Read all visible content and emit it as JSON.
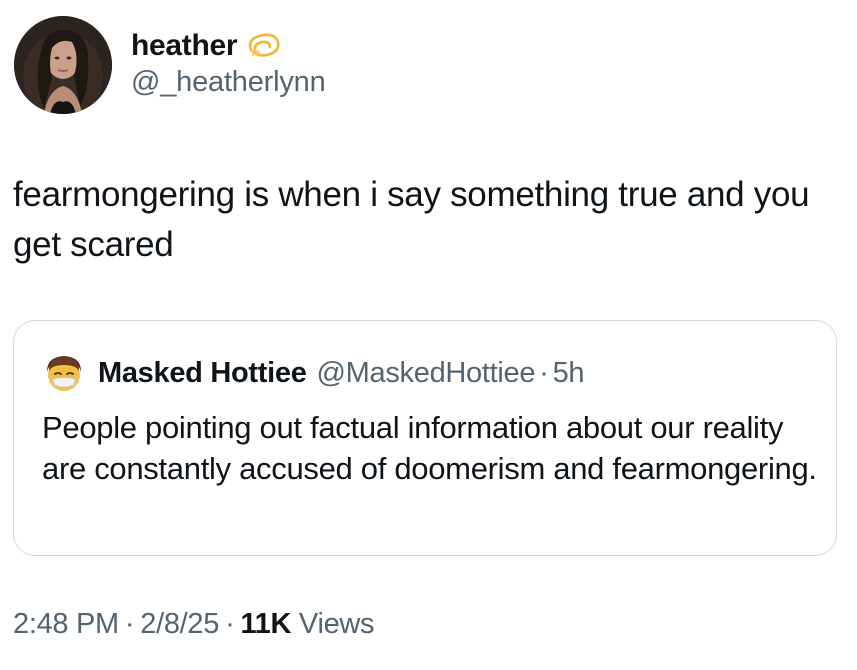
{
  "author": {
    "display_name": "heather",
    "handle": "@_heatherlynn",
    "badge_icon": "dizzy-star-emoji-icon",
    "avatar_icon": "profile-photo-avatar"
  },
  "tweet": {
    "text": "fearmongering is when i say something true and you get scared"
  },
  "quoted_tweet": {
    "avatar_icon": "face-with-mask-emoji-avatar",
    "display_name": "Masked Hottiee",
    "handle": "@MaskedHottiee",
    "separator": "·",
    "time": "5h",
    "text": "People pointing out factual information about our reality are constantly accused of doomerism and fearmongering."
  },
  "meta": {
    "time": "2:48 PM",
    "separator": "·",
    "date": "2/8/25",
    "views_count": "11K",
    "views_label": "Views"
  },
  "colors": {
    "text_primary": "#0f1419",
    "text_secondary": "#536471",
    "border": "#cfd9de",
    "background": "#ffffff"
  }
}
